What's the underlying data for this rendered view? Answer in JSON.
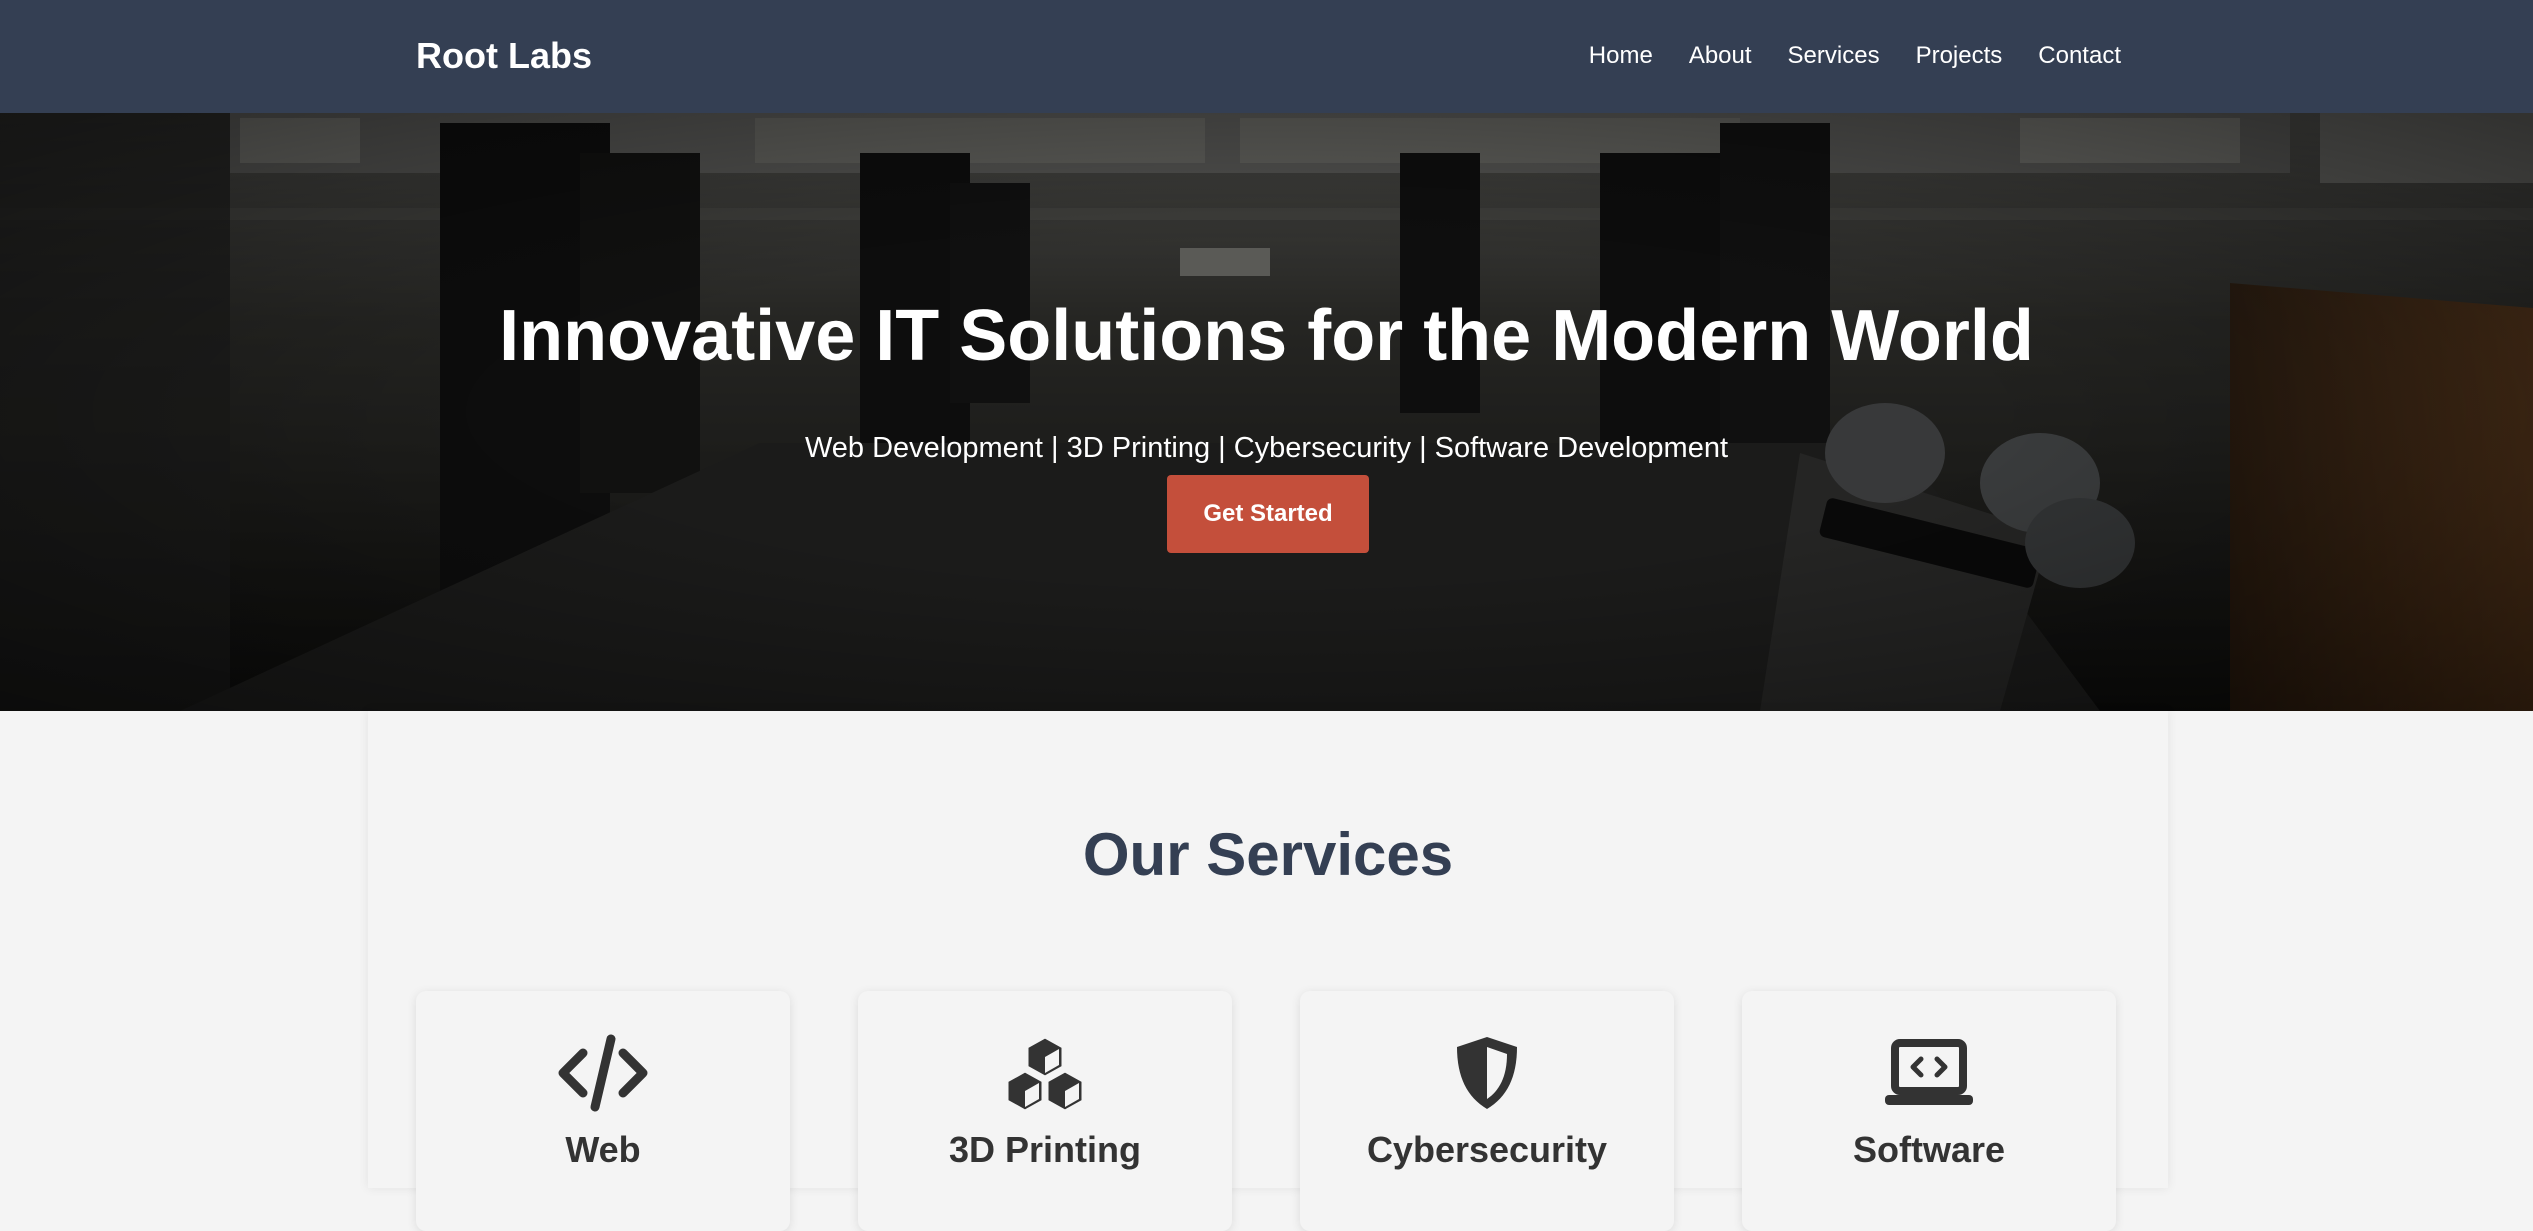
{
  "header": {
    "brand": "Root Labs",
    "nav": [
      "Home",
      "About",
      "Services",
      "Projects",
      "Contact"
    ]
  },
  "hero": {
    "title": "Innovative IT Solutions for the Modern World",
    "subtitle": "Web Development | 3D Printing | Cybersecurity | Software Development",
    "cta_label": "Get Started"
  },
  "services": {
    "title": "Our Services",
    "cards": [
      {
        "title": "Web",
        "icon": "code-icon"
      },
      {
        "title": "3D Printing",
        "icon": "cubes-icon"
      },
      {
        "title": "Cybersecurity",
        "icon": "shield-icon"
      },
      {
        "title": "Software",
        "icon": "laptop-code-icon"
      }
    ]
  },
  "colors": {
    "header_bg": "#343f53",
    "accent": "#c44f3b",
    "heading": "#343f53",
    "page_bg": "#f4f4f4"
  }
}
